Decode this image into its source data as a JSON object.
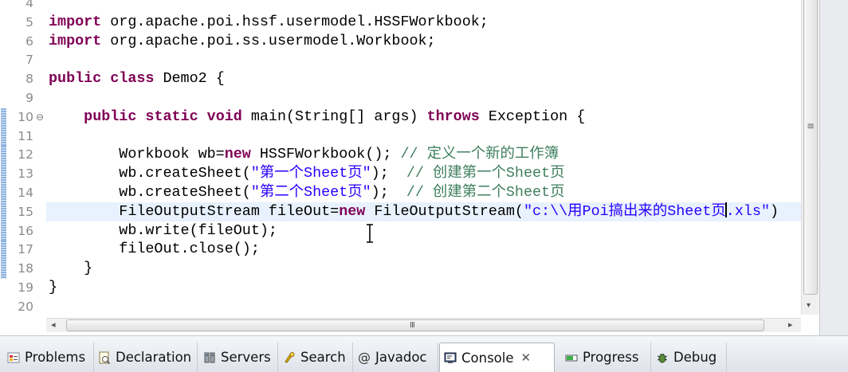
{
  "editor": {
    "current_line": 15,
    "changed_lines_from": 10,
    "changed_lines_to": 18,
    "folded_marker_line": 10,
    "lines": [
      {
        "n": "4",
        "tokens": []
      },
      {
        "n": "5",
        "tokens": [
          {
            "t": "kw",
            "s": "import"
          },
          {
            "t": "pl",
            "s": " org.apache.poi.hssf.usermodel.HSSFWorkbook;"
          }
        ]
      },
      {
        "n": "6",
        "tokens": [
          {
            "t": "kw",
            "s": "import"
          },
          {
            "t": "pl",
            "s": " org.apache.poi.ss.usermodel.Workbook;"
          }
        ]
      },
      {
        "n": "7",
        "tokens": []
      },
      {
        "n": "8",
        "tokens": [
          {
            "t": "kw",
            "s": "public class"
          },
          {
            "t": "pl",
            "s": " Demo2 {"
          }
        ]
      },
      {
        "n": "9",
        "tokens": []
      },
      {
        "n": "10",
        "tokens": [
          {
            "t": "pl",
            "s": "    "
          },
          {
            "t": "kw",
            "s": "public static void"
          },
          {
            "t": "pl",
            "s": " main(String[] args) "
          },
          {
            "t": "kw",
            "s": "throws"
          },
          {
            "t": "pl",
            "s": " Exception {"
          }
        ]
      },
      {
        "n": "11",
        "tokens": []
      },
      {
        "n": "12",
        "tokens": [
          {
            "t": "pl",
            "s": "        Workbook wb="
          },
          {
            "t": "kw",
            "s": "new"
          },
          {
            "t": "pl",
            "s": " HSSFWorkbook(); "
          },
          {
            "t": "cmt",
            "s": "// 定义一个新的工作簿"
          }
        ]
      },
      {
        "n": "13",
        "tokens": [
          {
            "t": "pl",
            "s": "        wb.createSheet("
          },
          {
            "t": "str",
            "s": "\"第一个Sheet页\""
          },
          {
            "t": "pl",
            "s": ");  "
          },
          {
            "t": "cmt",
            "s": "// 创建第一个Sheet页"
          }
        ]
      },
      {
        "n": "14",
        "tokens": [
          {
            "t": "pl",
            "s": "        wb.createSheet("
          },
          {
            "t": "str",
            "s": "\"第二个Sheet页\""
          },
          {
            "t": "pl",
            "s": ");  "
          },
          {
            "t": "cmt",
            "s": "// 创建第二个Sheet页"
          }
        ]
      },
      {
        "n": "15",
        "tokens": [
          {
            "t": "pl",
            "s": "        FileOutputStream fileOut="
          },
          {
            "t": "kw",
            "s": "new"
          },
          {
            "t": "pl",
            "s": " FileOutputStream("
          },
          {
            "t": "str",
            "s": "\"c:\\\\用Poi搞出来的Sheet页"
          },
          {
            "t": "caret"
          },
          {
            "t": "str",
            "s": ".xls\""
          },
          {
            "t": "pl",
            "s": ")"
          }
        ]
      },
      {
        "n": "16",
        "tokens": [
          {
            "t": "pl",
            "s": "        wb.write(fileOut);"
          }
        ]
      },
      {
        "n": "17",
        "tokens": [
          {
            "t": "pl",
            "s": "        fileOut.close();"
          }
        ]
      },
      {
        "n": "18",
        "tokens": [
          {
            "t": "pl",
            "s": "    }"
          }
        ]
      },
      {
        "n": "19",
        "tokens": [
          {
            "t": "pl",
            "s": "}"
          }
        ]
      },
      {
        "n": "20",
        "tokens": []
      }
    ]
  },
  "scrollbars": {
    "vertical_grip": "≡",
    "horizontal_grip": "III",
    "left_arrow": "◂",
    "right_arrow": "▸",
    "down_arrow": "▾"
  },
  "views": {
    "tabs": [
      {
        "label": "Problems",
        "icon": "problems-icon"
      },
      {
        "label": "Declaration",
        "icon": "declaration-icon"
      },
      {
        "label": "Servers",
        "icon": "servers-icon"
      },
      {
        "label": "Search",
        "icon": "search-icon"
      },
      {
        "label": "Javadoc",
        "icon": "javadoc-icon"
      },
      {
        "label": "Console",
        "icon": "console-icon",
        "active": true
      },
      {
        "label": "Progress",
        "icon": "progress-icon"
      },
      {
        "label": "Debug",
        "icon": "debug-icon"
      }
    ],
    "close_glyph": "✕"
  },
  "colors": {
    "keyword": "#7f0055",
    "string": "#2a00ff",
    "comment": "#3f7f5f",
    "current_line": "#e8f2fe"
  }
}
